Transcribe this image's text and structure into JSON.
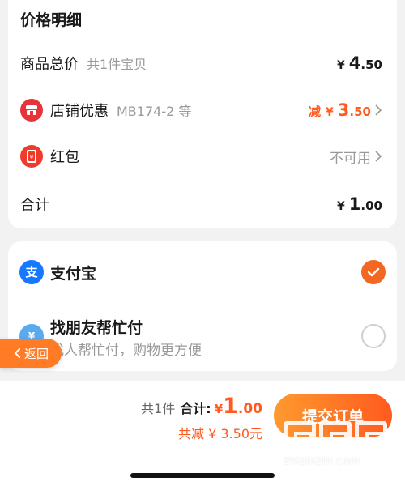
{
  "price_section": {
    "title": "价格明细",
    "goods_total": {
      "label": "商品总价",
      "sub": "共1件宝贝",
      "currency": "¥",
      "int": "4",
      "dec": ".50"
    },
    "shop_discount": {
      "label": "店铺优惠",
      "sub": "MB174-2 等",
      "prefix": "减",
      "currency": "¥",
      "int": "3",
      "dec": ".50"
    },
    "red_packet": {
      "label": "红包",
      "status": "不可用"
    },
    "total": {
      "label": "合计",
      "currency": "¥",
      "int": "1",
      "dec": ".00"
    }
  },
  "payment_section": {
    "alipay": {
      "title": "支付宝",
      "selected": true
    },
    "friend_pay": {
      "title": "找朋友帮忙付",
      "sub": "找人帮忙付，购物更方便",
      "selected": false
    }
  },
  "back_tab": {
    "label": "返回"
  },
  "bottom_bar": {
    "count": "共1件",
    "total_label": "合计:",
    "currency": "¥",
    "int": "1",
    "dec": ".00",
    "saved": "共减 ¥ 3.50元",
    "submit_label": "提交订单"
  },
  "watermark": {
    "text": "zhizhizhi.com"
  },
  "colors": {
    "accent": "#ff5a1f",
    "orange_radio": "#f26722",
    "alipay_blue": "#1677ff",
    "friend_blue": "#5aaaf0",
    "shop_red": "#e7343a"
  }
}
